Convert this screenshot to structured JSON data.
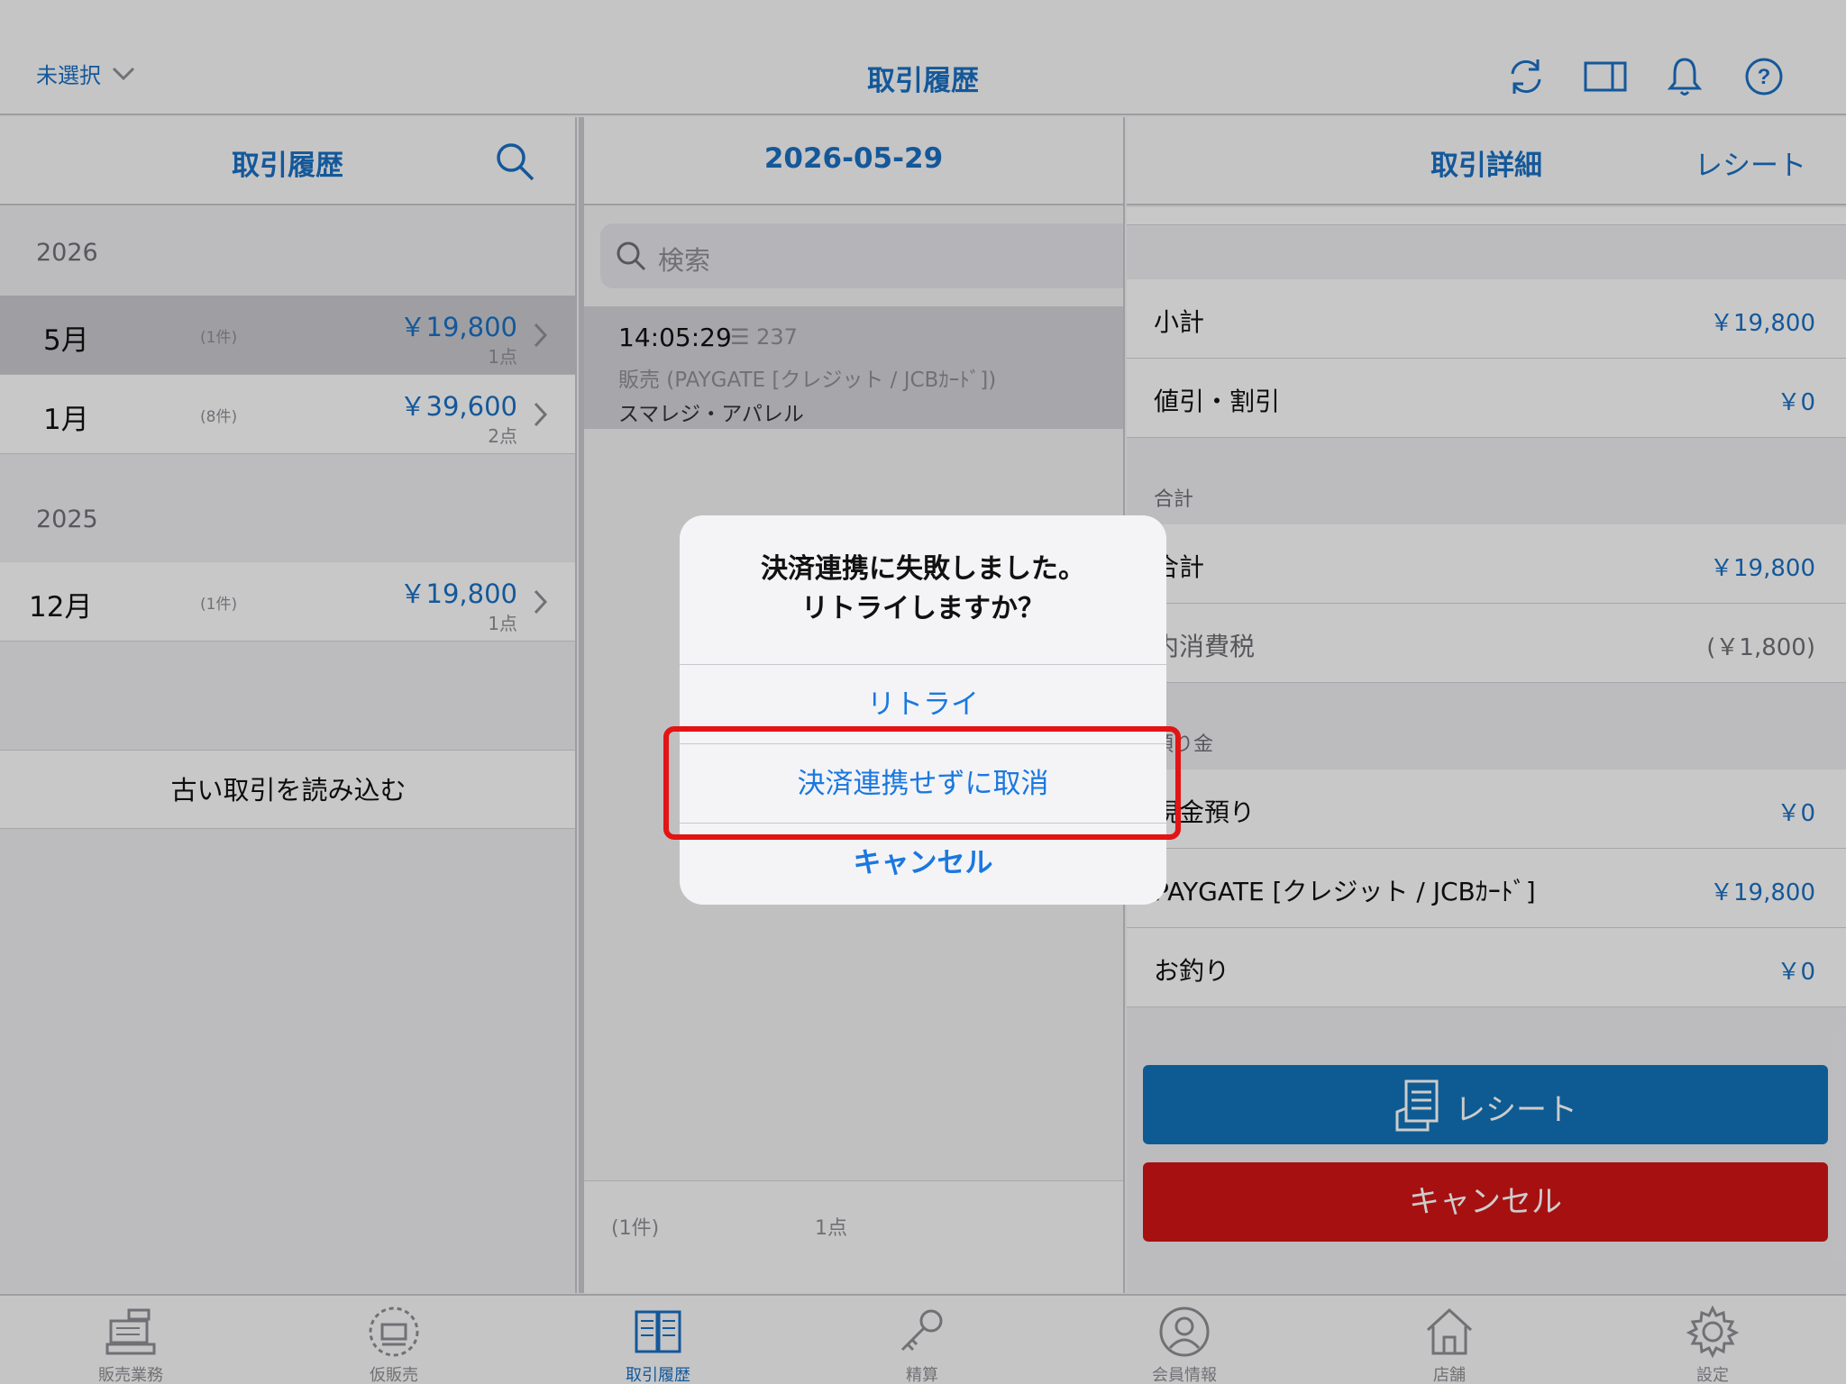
{
  "topbar": {
    "store_select": "未選択",
    "title": "取引履歴",
    "icons": [
      "refresh-icon",
      "split-view-icon",
      "bell-icon",
      "help-icon"
    ]
  },
  "left": {
    "title": "取引履歴",
    "years": [
      {
        "year": "2026",
        "months": [
          {
            "label": "5月",
            "count": "(1件)",
            "amount": "￥19,800",
            "items": "1点",
            "selected": true
          },
          {
            "label": "1月",
            "count": "(8件)",
            "amount": "￥39,600",
            "items": "2点",
            "selected": false
          }
        ]
      },
      {
        "year": "2025",
        "months": [
          {
            "label": "12月",
            "count": "(1件)",
            "amount": "￥19,800",
            "items": "1点",
            "selected": false
          }
        ]
      }
    ],
    "load_old": "古い取引を読み込む"
  },
  "mid": {
    "date": "2026-05-29",
    "search_placeholder": "検索",
    "transaction": {
      "time": "14:05:29",
      "number": "☰ 237",
      "desc": "販売 (PAYGATE [クレジット / JCBｶｰﾄﾞ])",
      "staff": "スマレジ・アパレル"
    },
    "footer_count": "(1件)",
    "footer_items": "1点"
  },
  "right": {
    "title": "取引詳細",
    "receipt_link": "レシート",
    "subtotal_label": "小計",
    "subtotal_value": "￥19,800",
    "discount_label": "値引・割引",
    "discount_value": "￥0",
    "section_total": "合計",
    "total_label": "合計",
    "total_value": "￥19,800",
    "tax_label": "内消費税",
    "tax_value": "(￥1,800)",
    "section_deposit": "預り金",
    "cash_label": "現金預り",
    "cash_value": "￥0",
    "card_label": "PAYGATE [クレジット / JCBｶｰﾄﾞ]",
    "card_value": "￥19,800",
    "change_label": "お釣り",
    "change_value": "￥0",
    "receipt_button": "レシート",
    "cancel_button": "キャンセル"
  },
  "tabs": [
    {
      "label": "販売業務",
      "icon": "register-icon",
      "active": false
    },
    {
      "label": "仮販売",
      "icon": "temp-sale-icon",
      "active": false
    },
    {
      "label": "取引履歴",
      "icon": "book-icon",
      "active": true
    },
    {
      "label": "精算",
      "icon": "key-icon",
      "active": false
    },
    {
      "label": "会員情報",
      "icon": "member-icon",
      "active": false
    },
    {
      "label": "店舗",
      "icon": "store-icon",
      "active": false
    },
    {
      "label": "設定",
      "icon": "gear-icon",
      "active": false
    }
  ],
  "alert": {
    "title_line1": "決済連携に失敗しました。",
    "title_line2": "リトライしますか？",
    "retry": "リトライ",
    "cancel_without_link": "決済連携せずに取消",
    "cancel": "キャンセル"
  },
  "colors": {
    "accent": "#1a6fc0",
    "receipt_button": "#1272b8",
    "cancel_button": "#d01515",
    "highlight": "#e21414"
  }
}
